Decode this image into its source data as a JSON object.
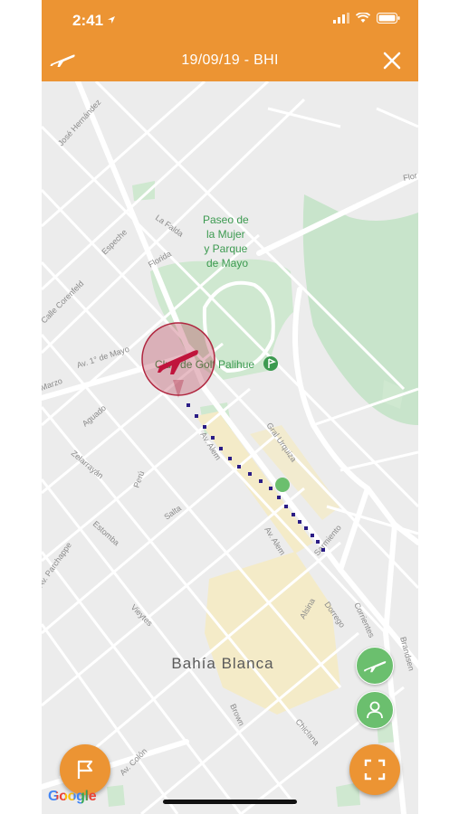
{
  "status_bar": {
    "time": "2:41",
    "location_icon": "location-arrow-icon",
    "signal_icon": "signal-bars-icon",
    "wifi_icon": "wifi-icon",
    "battery_icon": "battery-icon"
  },
  "navbar": {
    "title": "19/09/19 - BHI",
    "left_icon": "airplane-icon",
    "right_icon": "close-icon"
  },
  "map": {
    "city_label": "Bahía Blanca",
    "poi_paseo": [
      "Paseo de",
      "la Mujer",
      "y Parque",
      "de Mayo"
    ],
    "poi_golf": "Club de Golf Palihue",
    "streets": {
      "jose_hernandez": "José Hernández",
      "la_falda": "La Falda",
      "especie": "Espeche",
      "florida": "Florida",
      "corenfeld": "Calle Corenfeld",
      "av_1_mayo": "Av. 1° de Mayo",
      "marzo": "Marzo",
      "aguado": "Aguado",
      "zelarrayan": "Zelarrayán",
      "peru": "Perú",
      "salta": "Salta",
      "estomba": "Estomba",
      "vieytes": "Vieytes",
      "av_colon": "Av. Colón",
      "brown": "Brown",
      "chiclana": "Chiclana",
      "av_alem_1": "Av. Alem",
      "av_alem_2": "Av. Alem",
      "gral_urquiza": "Gral Urquiza",
      "sarmiento": "Sarmiento",
      "alsina": "Alsina",
      "dorrego": "Dorrego",
      "corrientes": "Corrientes",
      "brandsen": "Brandsen",
      "pilcomayo_vial": "Av. Parchappe",
      "flor": "Flor"
    },
    "colors": {
      "land": "#ececec",
      "park": "#c6e6c8",
      "water": "#d8e8d8",
      "downtown": "#f5ecc6",
      "road": "#ffffff",
      "route": "#2b1d86",
      "airport_marker": "#b0263f",
      "accent": "#ec9433",
      "current_location": "#6bbf6e"
    }
  },
  "buttons": {
    "flag_icon": "flag-icon",
    "fullscreen_icon": "fullscreen-icon",
    "plane_icon": "airplane-icon",
    "person_icon": "person-icon"
  },
  "attribution": {
    "google": "Google"
  }
}
